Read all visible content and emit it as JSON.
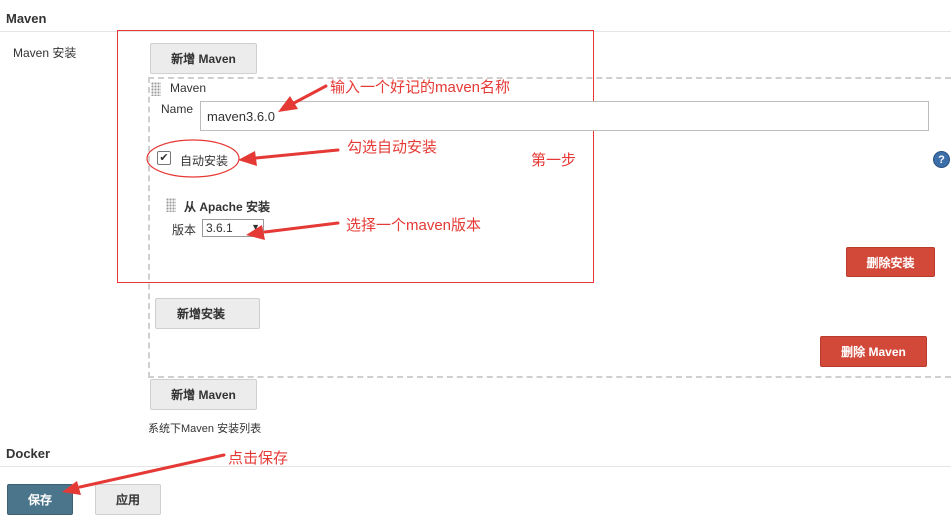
{
  "maven_section": {
    "title": "Maven",
    "label": "Maven 安装",
    "add_maven_top": "新增 Maven",
    "item_title": "Maven",
    "name_label": "Name",
    "name_value": "maven3.6.0",
    "auto_install_label": "自动安装",
    "auto_install_checked": true,
    "installer_title": "从 Apache 安装",
    "version_label": "版本",
    "version_value": "3.6.1",
    "delete_installer": "删除安装",
    "add_installer": "新增安装",
    "delete_maven": "删除 Maven",
    "add_maven_bottom": "新增 Maven",
    "list_note": "系统下Maven 安装列表"
  },
  "docker_section": {
    "title": "Docker"
  },
  "footer": {
    "save": "保存",
    "apply": "应用"
  },
  "annotations": {
    "name_hint": "输入一个好记的maven名称",
    "auto_install_hint": "勾选自动安装",
    "step": "第一步",
    "version_hint": "选择一个maven版本",
    "save_hint": "点击保存"
  },
  "colors": {
    "annotation_red": "#e53935",
    "delete_red": "#d24939",
    "save_blue": "#4b758b"
  }
}
